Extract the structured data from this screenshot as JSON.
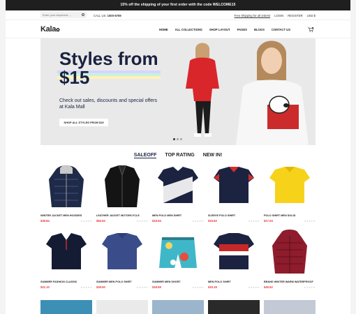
{
  "promo": "15% off the shipping of your first order with the code WELCOME15",
  "utilbar": {
    "search_placeholder": "Enter your keywords ...",
    "call_label": "CALL US:",
    "call_number": "1500-6789",
    "free_shipping": "Free Shipping for all orders!",
    "login": "LOGIN",
    "register": "REGISTER",
    "currency": "USD $"
  },
  "header": {
    "logo": "Kala",
    "nav": [
      "HOME",
      "ALL COLLECTIONS",
      "SHOP LAYOUT",
      "PAGES",
      "BLOGS",
      "CONTACT US"
    ]
  },
  "hero": {
    "heading": "Styles from $15",
    "subtext": "Check out sales, discounts and special offers at Kala Mall",
    "cta": "SHOP ALL STYLES FROM $15"
  },
  "tabs": [
    "SALEOFF",
    "TOP RATING",
    "NEW IN!"
  ],
  "products": [
    {
      "name": "WINTER JACKET MEN HOODIES",
      "price": "$39.84"
    },
    {
      "name": "LEATHER JACKET MOTORCYCLE",
      "price": "$84.92"
    },
    {
      "name": "MEN POLO MEN SHIRT",
      "price": "$19.94"
    },
    {
      "name": "SLEEVE POLO SHIRT",
      "price": "$15.60"
    },
    {
      "name": "POLO SHIRT MEN SOLID",
      "price": "$17.04"
    },
    {
      "name": "SUMMER FASHION CLASSIC",
      "price": "$21.10"
    },
    {
      "name": "SUMMER MEN POLO SHIRT",
      "price": "$26.50"
    },
    {
      "name": "SUMMER MEN SHORT",
      "price": "$18.59"
    },
    {
      "name": "MEN POLO SHIRT",
      "price": "$15.18"
    },
    {
      "name": "BRAND WINTER WARM WATERPROOF",
      "price": "$40.52"
    }
  ],
  "colors": {
    "accent": "#e53935",
    "hero_text": "#1a2140",
    "promo_bg": "#1f1f1f"
  }
}
